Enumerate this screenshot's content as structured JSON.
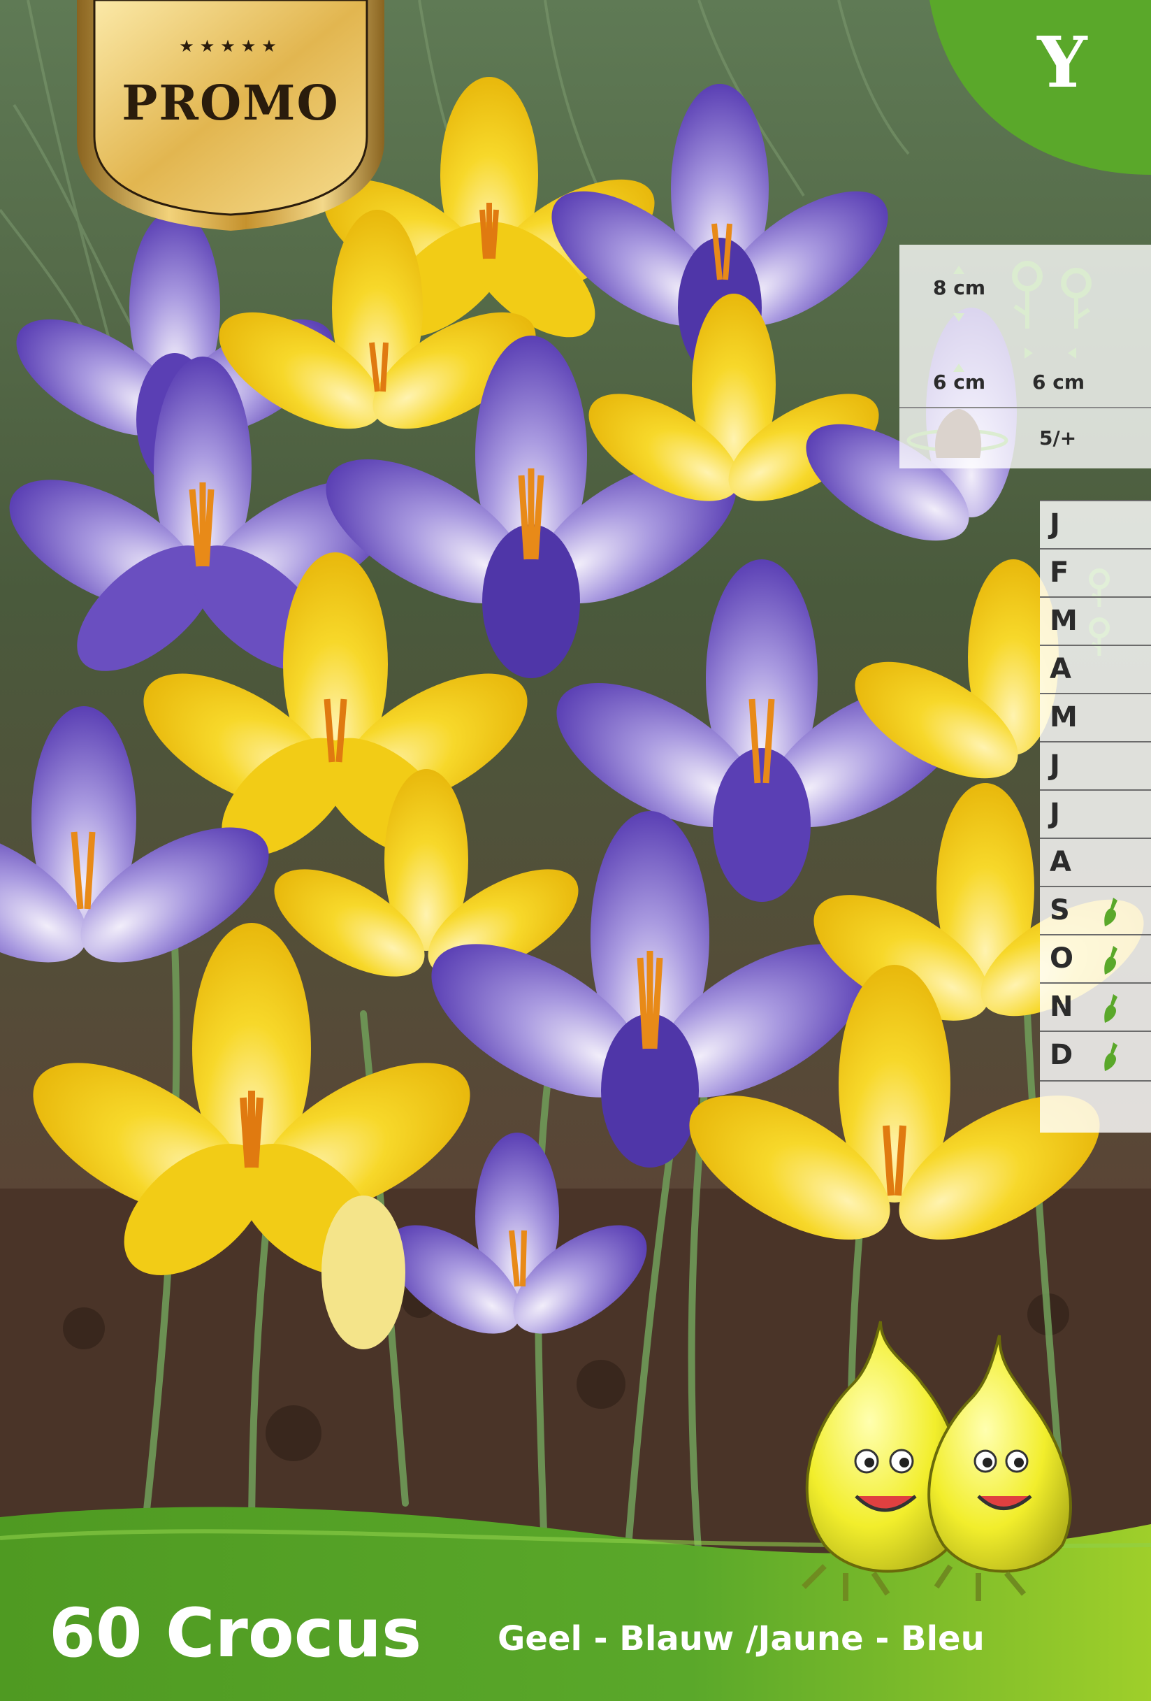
{
  "promo_badge": {
    "stars": "★★★★★",
    "label": "PROMO"
  },
  "variety_code": "Y",
  "planting_info": {
    "height": "8 cm",
    "depth": "6 cm",
    "spacing": "6 cm",
    "bulb_size": "5/+"
  },
  "calendar": {
    "months": [
      {
        "letter": "J",
        "icon": ""
      },
      {
        "letter": "F",
        "icon": "flower-icon"
      },
      {
        "letter": "M",
        "icon": "flower-icon"
      },
      {
        "letter": "A",
        "icon": ""
      },
      {
        "letter": "M",
        "icon": ""
      },
      {
        "letter": "J",
        "icon": ""
      },
      {
        "letter": "J",
        "icon": ""
      },
      {
        "letter": "A",
        "icon": ""
      },
      {
        "letter": "S",
        "icon": "trowel-icon"
      },
      {
        "letter": "O",
        "icon": "trowel-icon"
      },
      {
        "letter": "N",
        "icon": "trowel-icon"
      },
      {
        "letter": "D",
        "icon": "trowel-icon"
      }
    ]
  },
  "product": {
    "title": "60 Crocus",
    "subtitle": "Geel - Blauw /Jaune - Bleu"
  },
  "colors": {
    "green_band": "#5aa82a",
    "yellow_flower": "#f5cf1a",
    "purple_flower": "#6a4fc0",
    "gold": "#d4a63a"
  }
}
